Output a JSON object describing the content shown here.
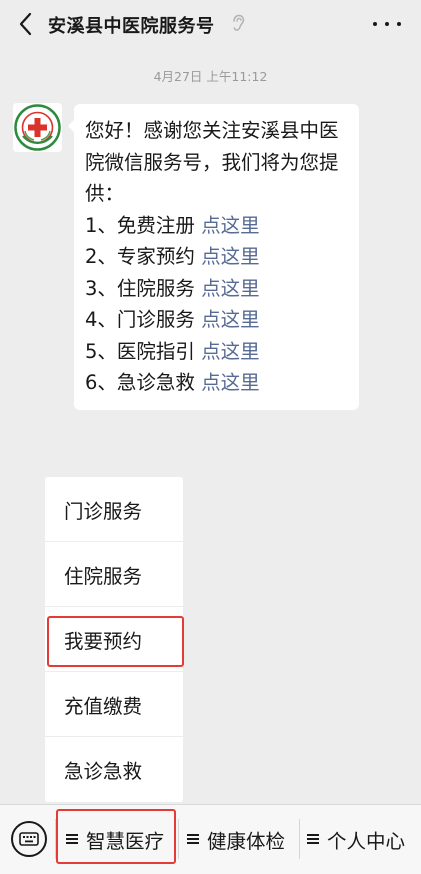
{
  "header": {
    "back_icon": "chevron-left-icon",
    "title": "安溪县中医院服务号",
    "mute_icon": "ear-icon",
    "more_icon": "more-dots-icon"
  },
  "chat": {
    "timestamp": "4月27日 上午11:12",
    "avatar": {
      "icon": "hospital-logo",
      "logo_text": "安溪县中医院"
    },
    "message": {
      "intro": "您好！感谢您关注安溪县中医院微信服务号，我们将为您提供：",
      "items": [
        {
          "label": "1、免费注册 ",
          "link": "点这里"
        },
        {
          "label": "2、专家预约 ",
          "link": "点这里"
        },
        {
          "label": "3、住院服务 ",
          "link": "点这里"
        },
        {
          "label": "4、门诊服务 ",
          "link": "点这里"
        },
        {
          "label": "5、医院指引 ",
          "link": "点这里"
        },
        {
          "label": "6、急诊急救 ",
          "link": "点这里"
        }
      ]
    }
  },
  "popup_menu": {
    "items": [
      "门诊服务",
      "住院服务",
      "我要预约",
      "充值缴费",
      "急诊急救"
    ],
    "highlighted_index": 2,
    "highlight_color": "#e53a35"
  },
  "menubar": {
    "keyboard_icon": "keyboard-icon",
    "tabs": [
      {
        "label": "智慧医疗",
        "icon": "menu-lines-icon"
      },
      {
        "label": "健康体检",
        "icon": "menu-lines-icon"
      },
      {
        "label": "个人中心",
        "icon": "menu-lines-icon"
      }
    ]
  },
  "colors": {
    "background": "#ededed",
    "bubble": "#ffffff",
    "link": "#576b95",
    "highlight": "#e53a35"
  }
}
